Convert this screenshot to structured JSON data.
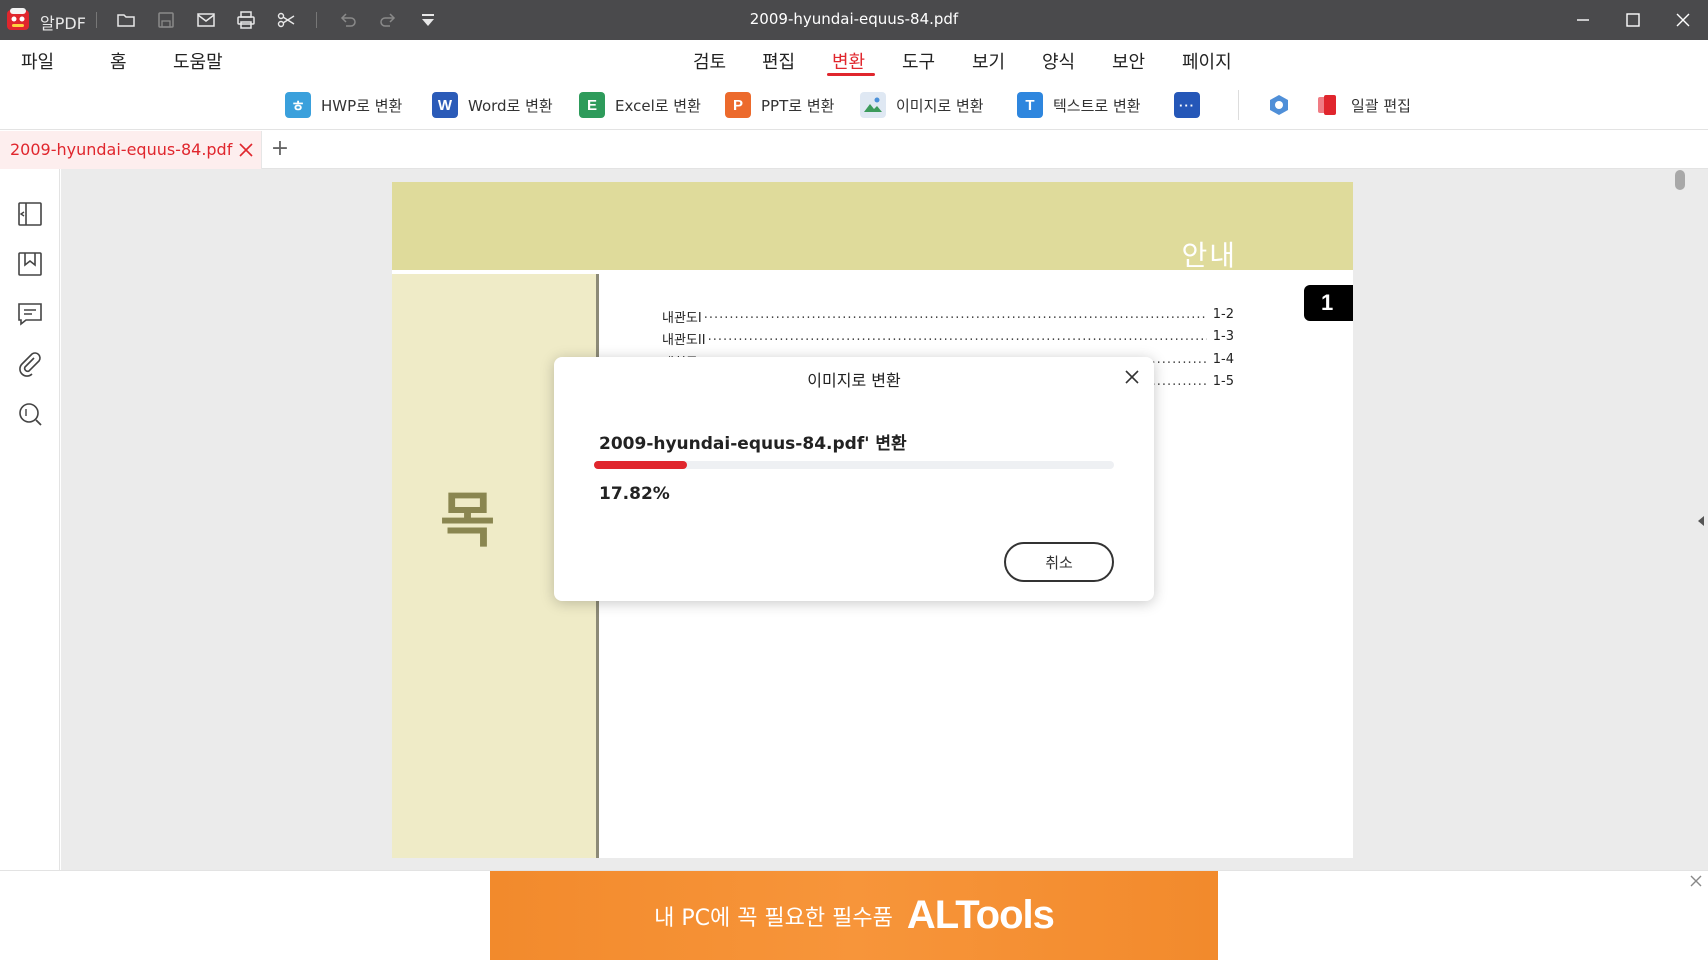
{
  "app": {
    "name": "알PDF",
    "window_title": "2009-hyundai-equus-84.pdf"
  },
  "menu": {
    "left": [
      "파일",
      "홈",
      "도움말"
    ],
    "center": [
      "검토",
      "편집",
      "변환",
      "도구",
      "보기",
      "양식",
      "보안",
      "페이지"
    ],
    "active": "변환"
  },
  "ribbon": {
    "hwp": "HWP로 변환",
    "word": "Word로 변환",
    "excel": "Excel로 변환",
    "ppt": "PPT로 변환",
    "image": "이미지로 변환",
    "text": "텍스트로 변환",
    "batch": "일괄 편집"
  },
  "tab": {
    "label": "2009-hyundai-equus-84.pdf",
    "add": "+"
  },
  "page": {
    "header_title": "안내",
    "toc_title": "목 차",
    "badge": "1",
    "toc": [
      {
        "title": "내관도I",
        "page": "1-2"
      },
      {
        "title": "내관도II",
        "page": "1-3"
      },
      {
        "title": "애칭류",
        "page": "1-4"
      },
      {
        "title": "",
        "page": "1-5"
      }
    ]
  },
  "dialog": {
    "title": "이미지로 변환",
    "file_text": "2009-hyundai-equus-84.pdf' 변환",
    "progress_pct": 17.82,
    "progress_label": "17.82%",
    "cancel": "취소"
  },
  "ad": {
    "text": "내 PC에 꼭 필요한 필수품",
    "brand": "ALTools"
  },
  "colors": {
    "accent": "#e0262d",
    "titlebar": "#4a4a4c",
    "page_header": "#dfdb9b",
    "page_side": "#efebc7",
    "ad": "#f28a2c"
  }
}
